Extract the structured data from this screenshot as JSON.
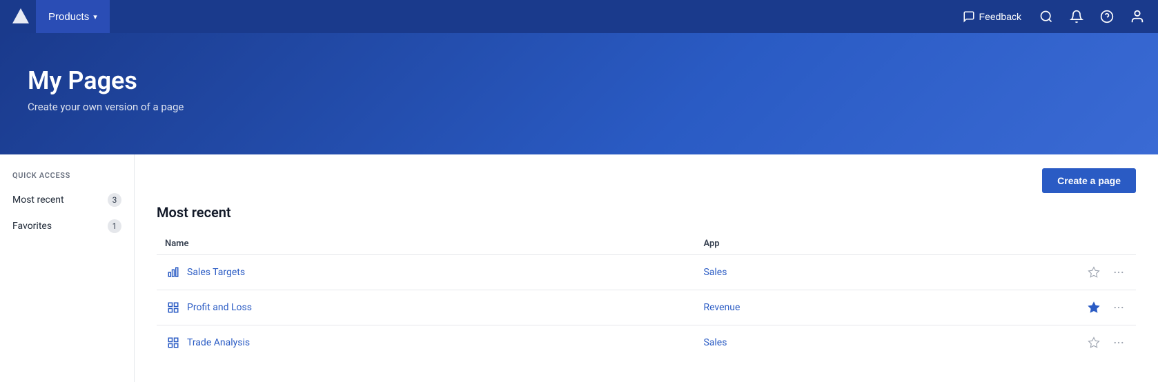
{
  "topnav": {
    "logo_alt": "Anaplan logo",
    "products_label": "Products",
    "feedback_label": "Feedback",
    "search_label": "Search",
    "notifications_label": "Notifications",
    "help_label": "Help",
    "user_label": "User profile",
    "chevron": "▾"
  },
  "hero": {
    "title": "My Pages",
    "subtitle": "Create your own version of a page"
  },
  "sidebar": {
    "section_label": "QUICK ACCESS",
    "items": [
      {
        "label": "Most recent",
        "count": "3"
      },
      {
        "label": "Favorites",
        "count": "1"
      }
    ]
  },
  "content": {
    "create_page_label": "Create a page",
    "section_title": "Most recent",
    "table": {
      "headers": [
        {
          "key": "name",
          "label": "Name"
        },
        {
          "key": "app",
          "label": "App"
        }
      ],
      "rows": [
        {
          "name": "Sales Targets",
          "app": "Sales",
          "favorited": false,
          "icon_type": "chart-bar"
        },
        {
          "name": "Profit and Loss",
          "app": "Revenue",
          "favorited": true,
          "icon_type": "grid"
        },
        {
          "name": "Trade Analysis",
          "app": "Sales",
          "favorited": false,
          "icon_type": "grid"
        }
      ]
    }
  }
}
